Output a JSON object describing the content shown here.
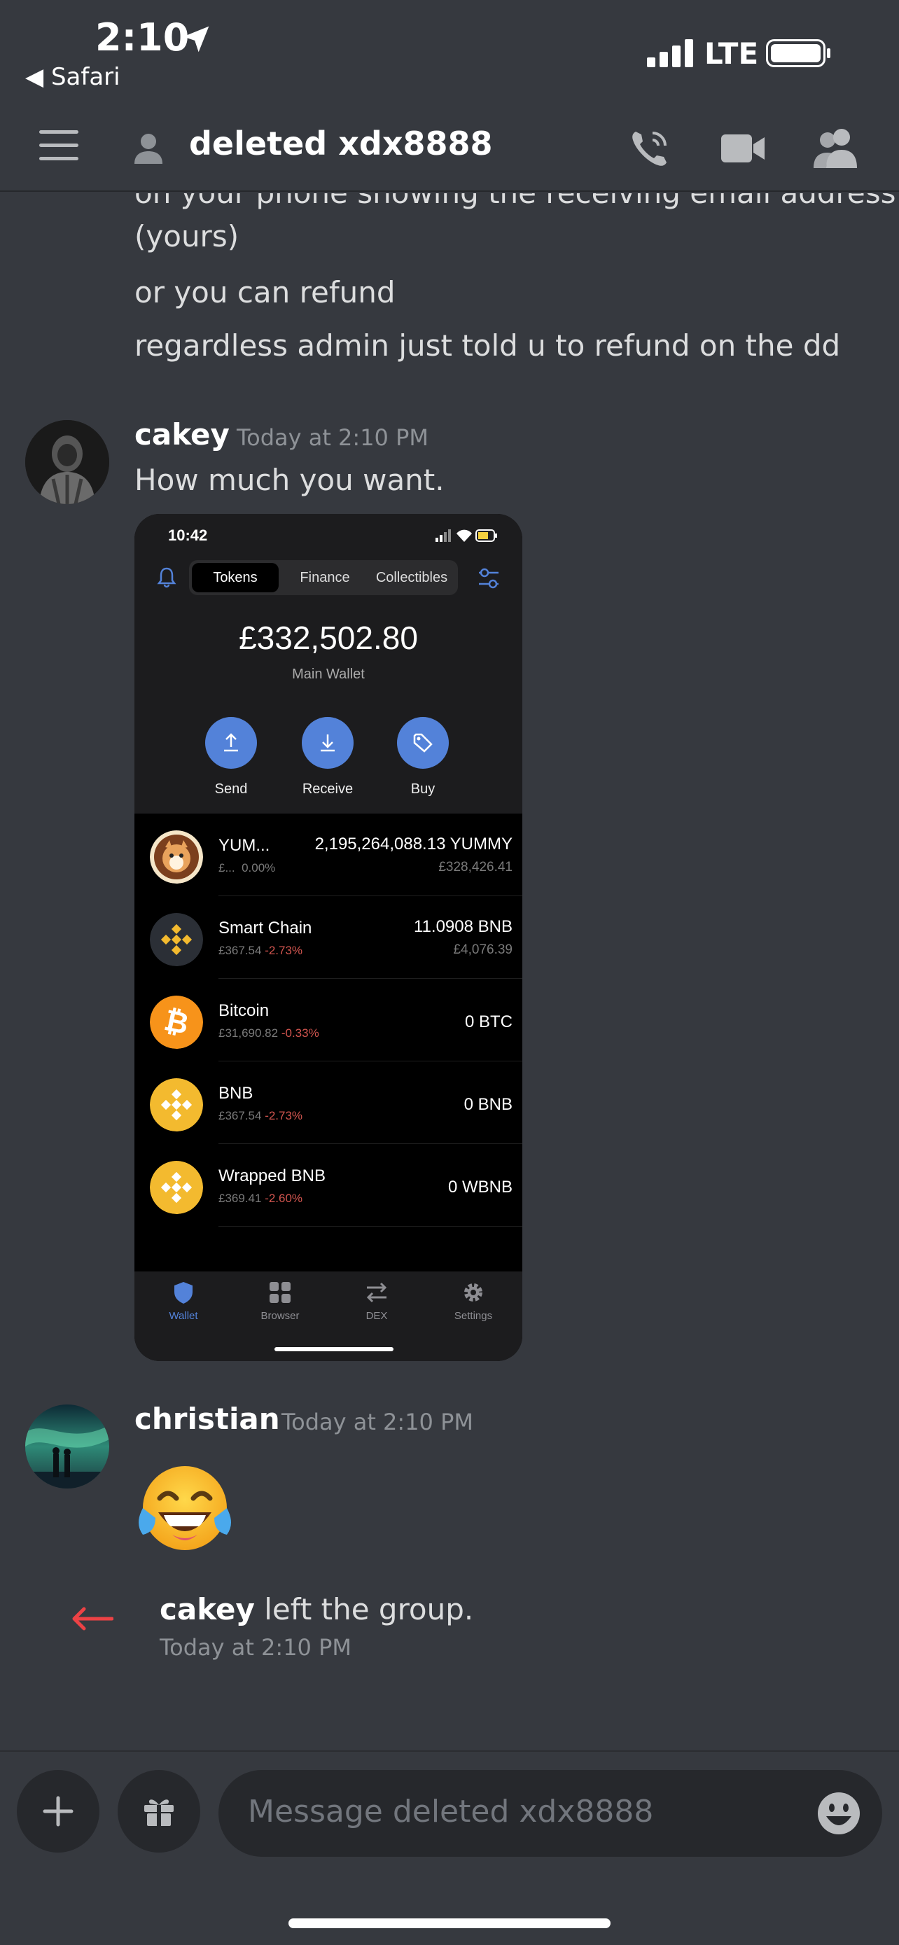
{
  "status_bar": {
    "time": "2:10",
    "back_app": "◀ Safari",
    "network": "LTE"
  },
  "header": {
    "title": "deleted xdx8888"
  },
  "messages": {
    "continued_lines": [
      "on your phone showing the receiving email address",
      "(yours)",
      "or you can refund",
      "regardless admin just told u to refund on the dd"
    ],
    "cakey": {
      "username": "cakey",
      "timestamp": "Today at 2:10 PM",
      "text": "How much you want."
    },
    "christian": {
      "username": "christian",
      "timestamp": "Today at 2:10 PM",
      "emoji": "face-with-tears-of-joy"
    },
    "system": {
      "user": "cakey",
      "action": "left the group.",
      "timestamp": "Today at 2:10 PM"
    }
  },
  "attachment": {
    "time": "10:42",
    "tabs": [
      "Tokens",
      "Finance",
      "Collectibles"
    ],
    "active_tab": "Tokens",
    "balance": "£332,502.80",
    "wallet_label": "Main Wallet",
    "actions": [
      "Send",
      "Receive",
      "Buy"
    ],
    "tokens": [
      {
        "name": "YUM...",
        "sub_price": "£...",
        "sub_change": "0.00%",
        "amount": "2,195,264,088.13 YUMMY",
        "value": "£328,426.41"
      },
      {
        "name": "Smart Chain",
        "sub_price": "£367.54",
        "sub_change": "-2.73%",
        "amount": "11.0908 BNB",
        "value": "£4,076.39"
      },
      {
        "name": "Bitcoin",
        "sub_price": "£31,690.82",
        "sub_change": "-0.33%",
        "amount": "0 BTC",
        "value": ""
      },
      {
        "name": "BNB",
        "sub_price": "£367.54",
        "sub_change": "-2.73%",
        "amount": "0 BNB",
        "value": ""
      },
      {
        "name": "Wrapped BNB",
        "sub_price": "£369.41",
        "sub_change": "-2.60%",
        "amount": "0 WBNB",
        "value": ""
      }
    ],
    "nav": [
      "Wallet",
      "Browser",
      "DEX",
      "Settings"
    ]
  },
  "composer": {
    "placeholder": "Message deleted xdx8888"
  },
  "colors": {
    "background": "#36393f",
    "accent_blue": "#5382d9",
    "system_arrow": "#ed4245",
    "negative": "#d2554f",
    "bnb_gold": "#f3ba2f",
    "btc_orange": "#f7931a"
  }
}
